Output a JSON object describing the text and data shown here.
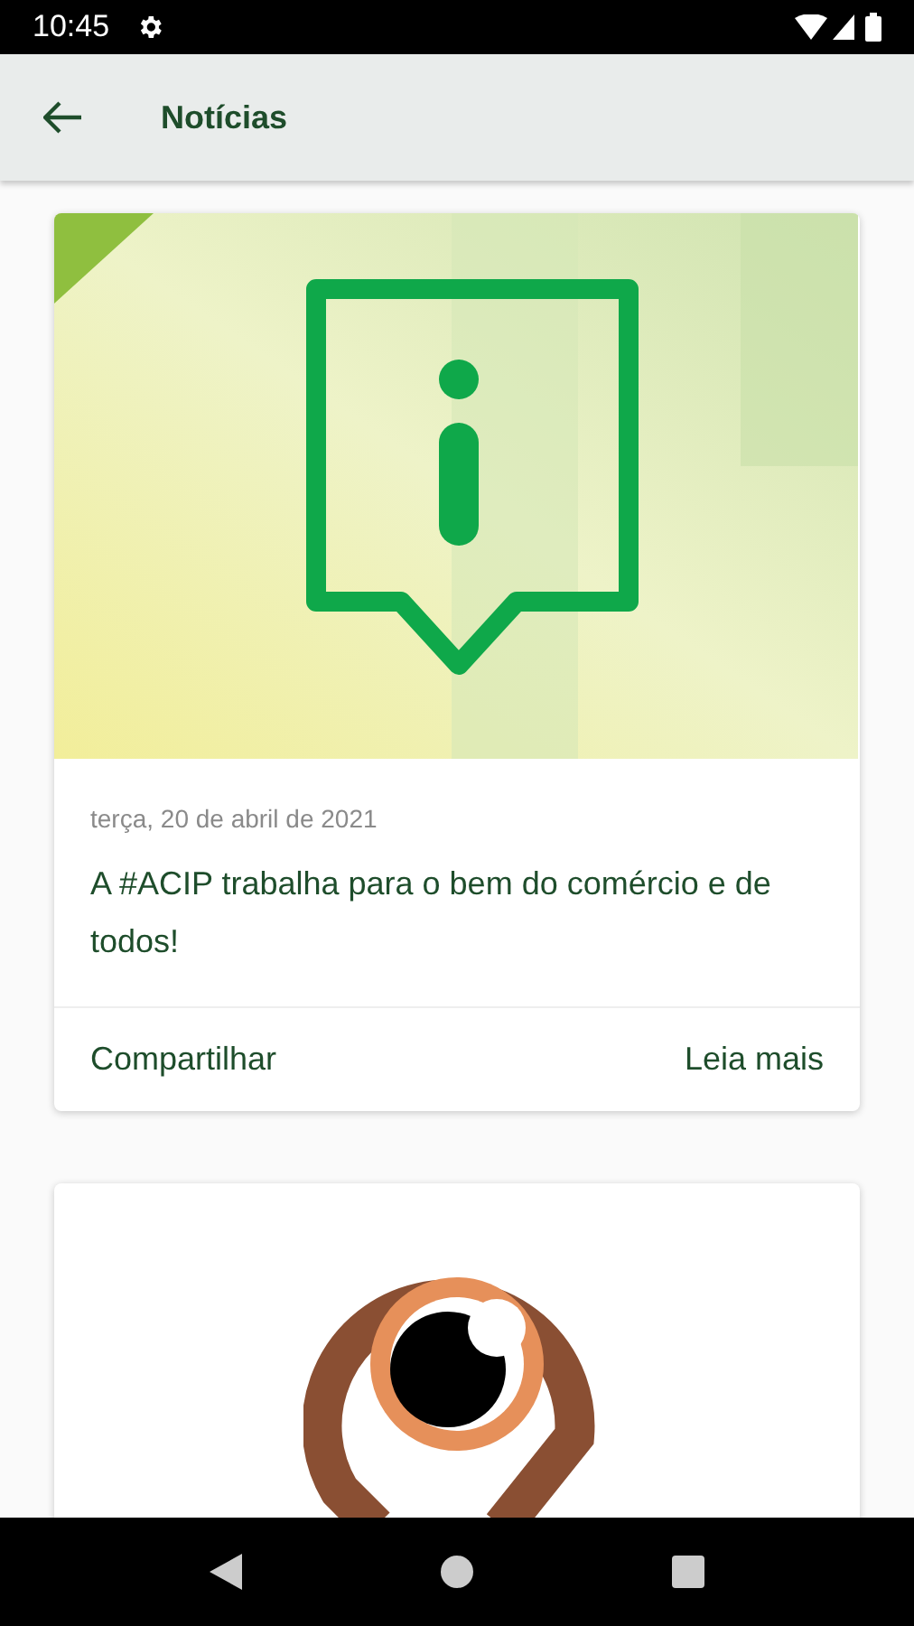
{
  "status_bar": {
    "time": "10:45"
  },
  "app_bar": {
    "title": "Notícias"
  },
  "news": [
    {
      "kind": "info",
      "date": "terça, 20 de abril de 2021",
      "headline": "A #ACIP trabalha para o bem do comércio e de todos!",
      "actions": [
        "Compartilhar",
        "Leia mais"
      ]
    },
    {
      "kind": "eye_pin"
    }
  ]
}
